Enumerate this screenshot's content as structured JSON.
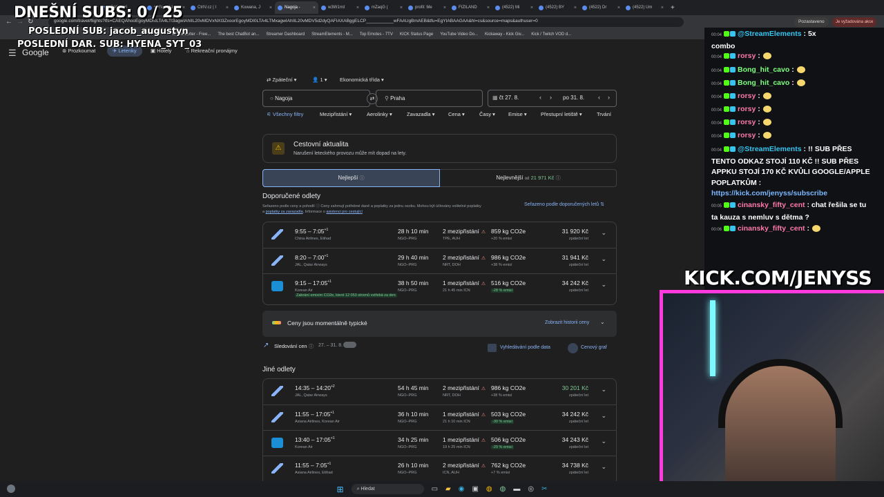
{
  "overlay": {
    "subs": "DNEŠNÍ SUBS: 0 / 25",
    "last_sub": "POSLEDNÍ SUB: jacob_augustyn",
    "last_gift": "POSLEDNÍ DAR. SUB: HYENA_SYT_03",
    "kick_url": "KICK.COM/JENYSS"
  },
  "browser": {
    "tabs": [
      "",
      "",
      "Betfin prí",
      "CtrlV.cz | I",
      "CtrlV.cz | I",
      "Kuwana, J",
      "Nagoja - ",
      "w3W1rrd",
      "mZaqG (",
      "profil: Me",
      "FIZILAND",
      "(4522) Mi",
      "(4522) BY",
      "(4522) Dr",
      "(4522) Um"
    ],
    "url": "google.com/travel/flights?tfs=CAEQAhooEgoyMDI0LTA4LTI3agwIAhIIL20vMDVxNXl3ZxoorEgoyMDI0LTA4LTMxagwIAhIIL20vMDV5d2dyQAFIAXABggELCP___________wFAAUgBmAEB&tfu=EgYIABAAGAA&hl=cs&source=maps&authuser=0",
    "bookmarks": [
      "le Converter - Free...",
      "The best ChatBot an...",
      "Streamer Dashboard",
      "StreamElements - M...",
      "Top Emotes - 7TV",
      "KICK Status Page",
      "YouTube Video Do...",
      "Kickaway - Kick Giv...",
      "Kick / Twitch VOD d..."
    ],
    "profile_label": "Pozastaveno",
    "update_label": "Je vyžadována akce"
  },
  "gnav": {
    "logo": "Google",
    "tabs": [
      "Prozkoumat",
      "Letenky",
      "Hotely",
      "Rekreační pronájmy"
    ]
  },
  "search": {
    "trip_type": "Zpáteční",
    "passengers": "1",
    "cabin": "Ekonomická třída",
    "from": "Nagoja",
    "to": "Praha",
    "depart": "čt 27. 8.",
    "return": "po 31. 8."
  },
  "filters": [
    "Všechny filtry",
    "Mezipřistání",
    "Aerolinky",
    "Zavazadla",
    "Cena",
    "Časy",
    "Emise",
    "Přestupní letiště",
    "Trvání"
  ],
  "alert": {
    "title": "Cestovní aktualita",
    "text": "Narušení leteckého provozu může mít dopad na lety."
  },
  "sort_tabs": {
    "best": "Nejlepší",
    "cheapest": "Nejlevnější",
    "cheapest_prefix": "od",
    "cheapest_price": "21 971 Kč"
  },
  "recommended": {
    "heading": "Doporučené odlety",
    "note": "Seřazeno podle ceny a pohodlí  ⓘ  Ceny zahrnují potřebné daně a poplatky za jednu osobu. Mohou být účtovány volitelné poplatky",
    "note2_a": "a",
    "note2_link1": "poplatky za zavazadla",
    "note2_b": ". Informace o",
    "note2_link2": "asistenci pro cestující",
    "sort_label": "Seřazeno podle doporučených letů"
  },
  "flights_best": [
    {
      "time": "9:55 – 7:05",
      "sup": "+1",
      "airline": "China Airlines, Etihad",
      "duration": "28 h 10 min",
      "route": "NGO–PRG",
      "stops": "2 mezipřistání",
      "stops_detail": "TPE, AUH",
      "co2": "859 kg CO2e",
      "co2_detail": "+20 % emisí",
      "price": "31 920 Kč",
      "price_note": "zpáteční let"
    },
    {
      "time": "8:20 – 7:00",
      "sup": "+1",
      "airline": "JAL, Qatar Airways",
      "duration": "29 h 40 min",
      "route": "NGO–PRG",
      "stops": "2 mezipřistání",
      "stops_detail": "NRT, DOH",
      "co2": "986 kg CO2e",
      "co2_detail": "+38 % emisí",
      "price": "31 941 Kč",
      "price_note": "zpáteční let"
    },
    {
      "time": "9:15 – 17:05",
      "sup": "+1",
      "airline": "Korean Air",
      "duration": "38 h 50 min",
      "route": "NGO–PRG",
      "stops": "1 mezipřistání",
      "stops_detail": "21 h 45 min ICN",
      "co2": "516 kg CO2e",
      "co2_detail": "-28 % emisí",
      "price": "34 242 Kč",
      "price_note": "zpáteční let",
      "eco_note": "Zabrání emisím CO2e, které 12 053 stromů vstřebá za den"
    }
  ],
  "price_insight": {
    "text": "Ceny jsou momentálně typické",
    "history_link": "Zobrazit historii ceny"
  },
  "tracking": {
    "label": "Sledování cen",
    "dates": "27. – 31. 8.",
    "date_grid": "Vyhledávání podle data",
    "price_graph": "Cenový graf"
  },
  "other": {
    "heading": "Jiné odlety"
  },
  "flights_other": [
    {
      "time": "14:35 – 14:20",
      "sup": "+2",
      "airline": "JAL, Qatar Airways",
      "duration": "54 h 45 min",
      "route": "NGO–PRG",
      "stops": "2 mezipřistání",
      "stops_detail": "NRT, DOH",
      "co2": "986 kg CO2e",
      "co2_detail": "+38 % emisí",
      "price": "30 201 Kč",
      "price_note": "zpáteční let",
      "price_green": true
    },
    {
      "time": "11:55 – 17:05",
      "sup": "+1",
      "airline": "Asiana Airlines, Korean Air",
      "duration": "36 h 10 min",
      "route": "NGO–PRG",
      "stops": "1 mezipřistání",
      "stops_detail": "21 h 10 min ICN",
      "co2": "503 kg CO2e",
      "co2_detail": "-30 % emisí",
      "price": "34 242 Kč",
      "price_note": "zpáteční let"
    },
    {
      "time": "13:40 – 17:05",
      "sup": "+1",
      "airline": "Korean Air",
      "duration": "34 h 25 min",
      "route": "NGO–PRG",
      "stops": "1 mezipřistání",
      "stops_detail": "19 h 25 min ICN",
      "co2": "506 kg CO2e",
      "co2_detail": "-29 % emisí",
      "price": "34 243 Kč",
      "price_note": "zpáteční let"
    },
    {
      "time": "11:55 – 7:05",
      "sup": "+1",
      "airline": "Asiana Airlines, Etihad",
      "duration": "26 h 10 min",
      "route": "NGO–PRG",
      "stops": "2 mezipřistání",
      "stops_detail": "ICN, AUH",
      "co2": "762 kg CO2e",
      "co2_detail": "+7 % emisí",
      "price": "34 738 Kč",
      "price_note": "zpáteční let"
    }
  ],
  "chat": [
    {
      "ts": "00:04",
      "user": "@StreamElements",
      "user_color": "#36c5f0",
      "text": ": 5x",
      "cont": "combo"
    },
    {
      "ts": "00:04",
      "user": "rorsy",
      "user_color": "#ff7aa8",
      "text": ":"
    },
    {
      "ts": "00:04",
      "user": "Bong_hit_cavo",
      "user_color": "#7fff7f",
      "text": ":"
    },
    {
      "ts": "00:04",
      "user": "Bong_hit_cavo",
      "user_color": "#7fff7f",
      "text": ":"
    },
    {
      "ts": "00:04",
      "user": "rorsy",
      "user_color": "#ff7aa8",
      "text": ":"
    },
    {
      "ts": "00:04",
      "user": "rorsy",
      "user_color": "#ff7aa8",
      "text": ":"
    },
    {
      "ts": "00:04",
      "user": "rorsy",
      "user_color": "#ff7aa8",
      "text": ":"
    },
    {
      "ts": "00:04",
      "user": "rorsy",
      "user_color": "#ff7aa8",
      "text": ":"
    },
    {
      "ts": "00:04",
      "user": "@StreamElements",
      "user_color": "#36c5f0",
      "text": ": !! SUB PŘES TENTO ODKAZ STOJÍ 110 KČ !! SUB PŘES APPKU STOJÍ 170 KČ KVŮLI GOOGLE/APPLE POPLATKŮM :",
      "link": "https://kick.com/jenyss/subscribe"
    },
    {
      "ts": "00:05",
      "user": "cinansky_fifty_cent",
      "user_color": "#ff7aa8",
      "text": ": chat řešila se tu ta kauza s nemluv s dětma ?"
    },
    {
      "ts": "00:06",
      "user": "cinansky_fifty_cent",
      "user_color": "#ff7aa8",
      "text": ":"
    }
  ],
  "taskbar": {
    "search_placeholder": "Hledat"
  }
}
